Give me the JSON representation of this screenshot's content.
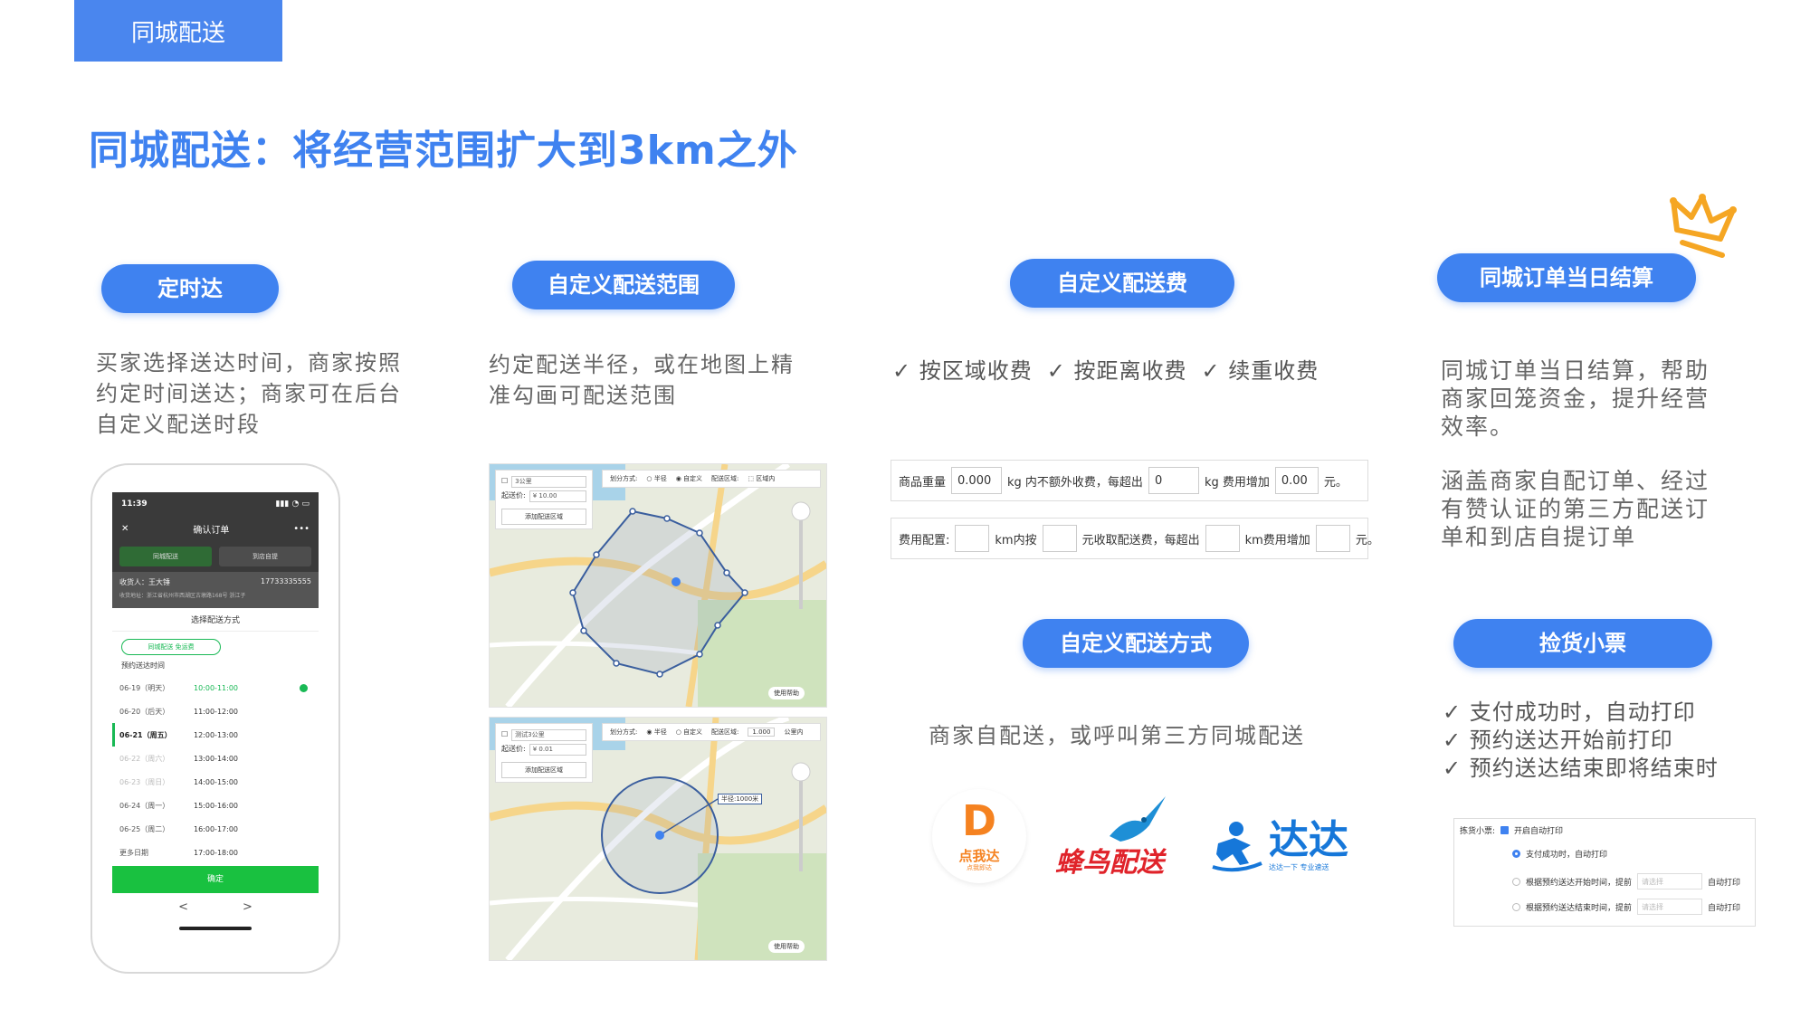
{
  "corner_tag": "同城配送",
  "title": "同城配送：将经营范围扩大到3km之外",
  "sections": {
    "timed": {
      "pill": "定时达",
      "desc": [
        "买家选择送达时间，商家按照",
        "约定时间送达；商家可在后台",
        "自定义配送时段"
      ]
    },
    "range": {
      "pill": "自定义配送范围",
      "desc": [
        "约定配送半径，或在地图上精",
        "准勾画可配送范围"
      ]
    },
    "fee": {
      "pill": "自定义配送费",
      "checks": [
        "✓ 按区域收费",
        "✓ 按距离收费",
        "✓ 续重收费"
      ],
      "form1": {
        "label": "商品重量",
        "v1": "0.000",
        "t1": "kg 内不额外收费，每超出",
        "v2": "0",
        "t2": "kg 费用增加",
        "v3": "0.00",
        "t3": "元。"
      },
      "form2": {
        "label": "费用配置:",
        "t1": "km内按",
        "t2": "元收取配送费，每超出",
        "t3": "km费用增加",
        "t4": "元。"
      }
    },
    "method": {
      "pill": "自定义配送方式",
      "desc": "商家自配送，或呼叫第三方同城配送",
      "logos": {
        "dianwoda": {
          "mark": "D",
          "name": "点我达",
          "slogan": "点我即达"
        },
        "fengniao": "蜂鸟配送",
        "dada": {
          "name": "达达",
          "slogan": "达达一下  专业速送"
        }
      }
    },
    "settle": {
      "pill": "同城订单当日结算",
      "desc1": [
        "同城订单当日结算，帮助",
        "商家回笼资金，提升经营",
        "效率。"
      ],
      "desc2": [
        "涵盖商家自配订单、经过",
        "有赞认证的第三方配送订",
        "单和到店自提订单"
      ]
    },
    "ticket": {
      "pill": "捡货小票",
      "checks": [
        "✓  支付成功时，自动打印",
        "✓  预约送达开始前打印",
        "✓  预约送达结束即将结束时"
      ],
      "form": {
        "label": "拣货小票:",
        "toggle": "开启自动打印",
        "opt1": "支付成功时，自动打印",
        "opt2": "根据预约送达开始时间，提前",
        "opt3": "根据预约送达结束时间，提前",
        "select_placeholder": "请选择",
        "suffix": "自动打印"
      }
    }
  },
  "phone": {
    "time": "11:39",
    "nav_title": "确认订单",
    "nav_left": "✕",
    "nav_right": "•••",
    "tab_on": "同城配送",
    "tab_off": "到店自提",
    "receiver": "收货人：王大锤",
    "phone": "17733335555",
    "address": "收货地址：浙江省杭州市西湖区古墩路168号 浙江子",
    "sheet_title": "选择配送方式",
    "chip": "同城配送 免运费",
    "sub": "预约送达时间",
    "rows": [
      {
        "d": "06-19（明天）",
        "t": "10:00-11:00"
      },
      {
        "d": "06-20（后天）",
        "t": "11:00-12:00"
      },
      {
        "d": "06-21（周五）",
        "t": "12:00-13:00"
      },
      {
        "d": "06-22（周六）",
        "t": "13:00-14:00"
      },
      {
        "d": "06-23（周日）",
        "t": "14:00-15:00"
      },
      {
        "d": "06-24（周一）",
        "t": "15:00-16:00"
      },
      {
        "d": "06-25（周二）",
        "t": "16:00-17:00"
      },
      {
        "d": "更多日期",
        "t": "17:00-18:00"
      }
    ],
    "confirm": "确定",
    "back": "<",
    "forward": ">"
  },
  "map1": {
    "area_name": "3公里",
    "fee_label": "起送价:",
    "fee_value": "¥  10.00",
    "add_btn": "添加配送区域",
    "bar_mode": "划分方式:",
    "opt_radius": "半径",
    "opt_custom": "自定义",
    "bar_area": "配送区域:",
    "bar_area_btn": "区域内",
    "help": "使用帮助"
  },
  "map2": {
    "area_name": "测试3公里",
    "fee_label": "起送价:",
    "fee_value": "¥  0.01",
    "add_btn": "添加配送区域",
    "bar_mode": "划分方式:",
    "opt_radius": "半径",
    "opt_custom": "自定义",
    "bar_area": "配送区域:",
    "bar_radius": "1.000",
    "bar_unit": "公里内",
    "radius_label": "半径:1000米",
    "help": "使用帮助"
  }
}
